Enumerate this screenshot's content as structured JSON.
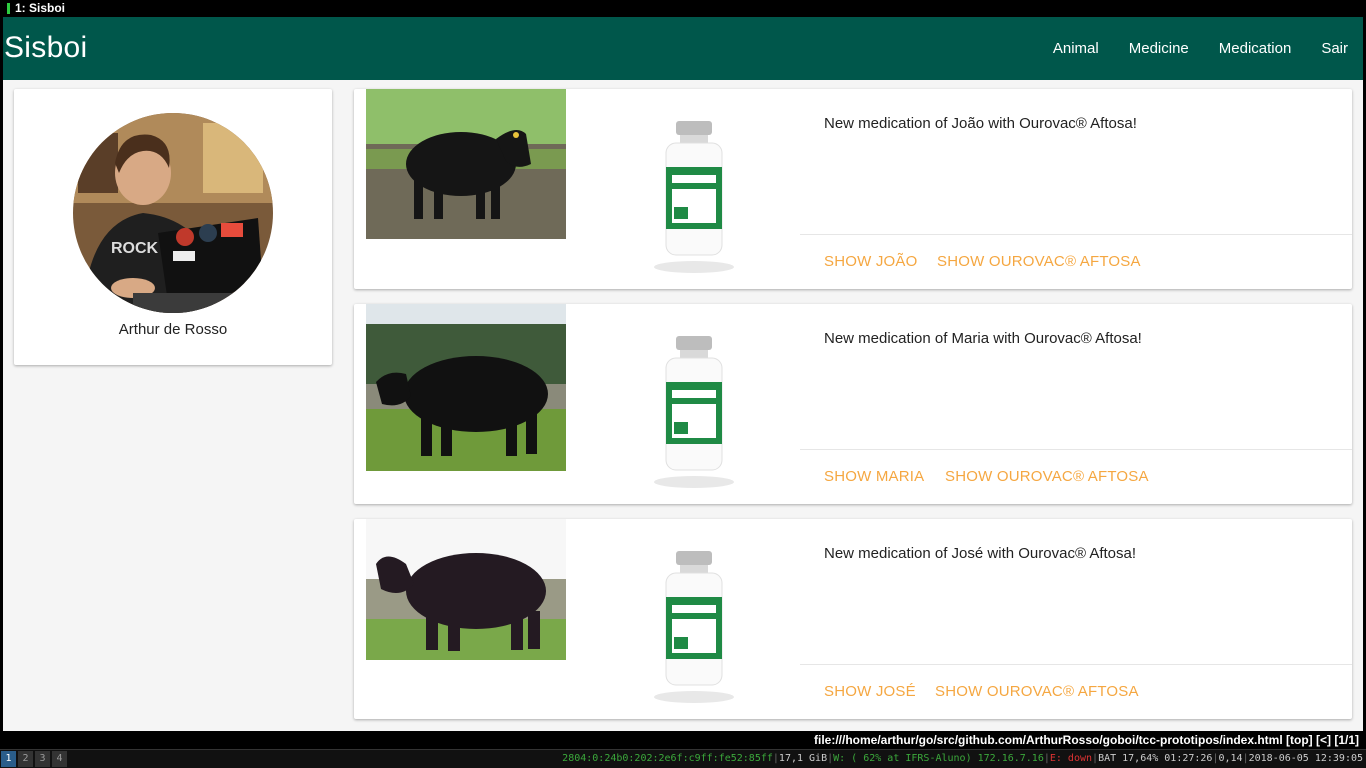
{
  "window": {
    "title": "1: Sisboi"
  },
  "app": {
    "brand": "Sisboi",
    "nav": [
      "Animal",
      "Medicine",
      "Medication",
      "Sair"
    ]
  },
  "profile": {
    "name": "Arthur de Rosso"
  },
  "feed": [
    {
      "text": "New medication of João with Ourovac® Aftosa!",
      "show_animal": "SHOW JOÃO",
      "show_medicine": "SHOW OUROVAC® AFTOSA"
    },
    {
      "text": "New medication of Maria with Ourovac® Aftosa!",
      "show_animal": "SHOW MARIA",
      "show_medicine": "SHOW OUROVAC® AFTOSA"
    },
    {
      "text": "New medication of José with Ourovac® Aftosa!",
      "show_animal": "SHOW JOSÉ",
      "show_medicine": "SHOW OUROVAC® AFTOSA"
    }
  ],
  "browser_status": "file:///home/arthur/go/src/github.com/ArthurRosso/goboi/tcc-prototipos/index.html  [top]  [<]  [1/1]",
  "wm_bar": {
    "workspaces": [
      "1",
      "2",
      "3",
      "4"
    ],
    "ipv6": "2804:0:24b0:202:2e6f:c9ff:fe52:85ff",
    "mem": "17,1 GiB",
    "wifi": "W: ( 62% at IFRS-Aluno) 172.16.7.16",
    "eth": "E: down",
    "battery": "BAT 17,64% 01:27:26",
    "load": "0,14",
    "datetime": "2018-06-05 12:39:05"
  },
  "colors": {
    "appbar": "#00574b",
    "accent": "#f5a741",
    "background": "#f5f5f5"
  }
}
